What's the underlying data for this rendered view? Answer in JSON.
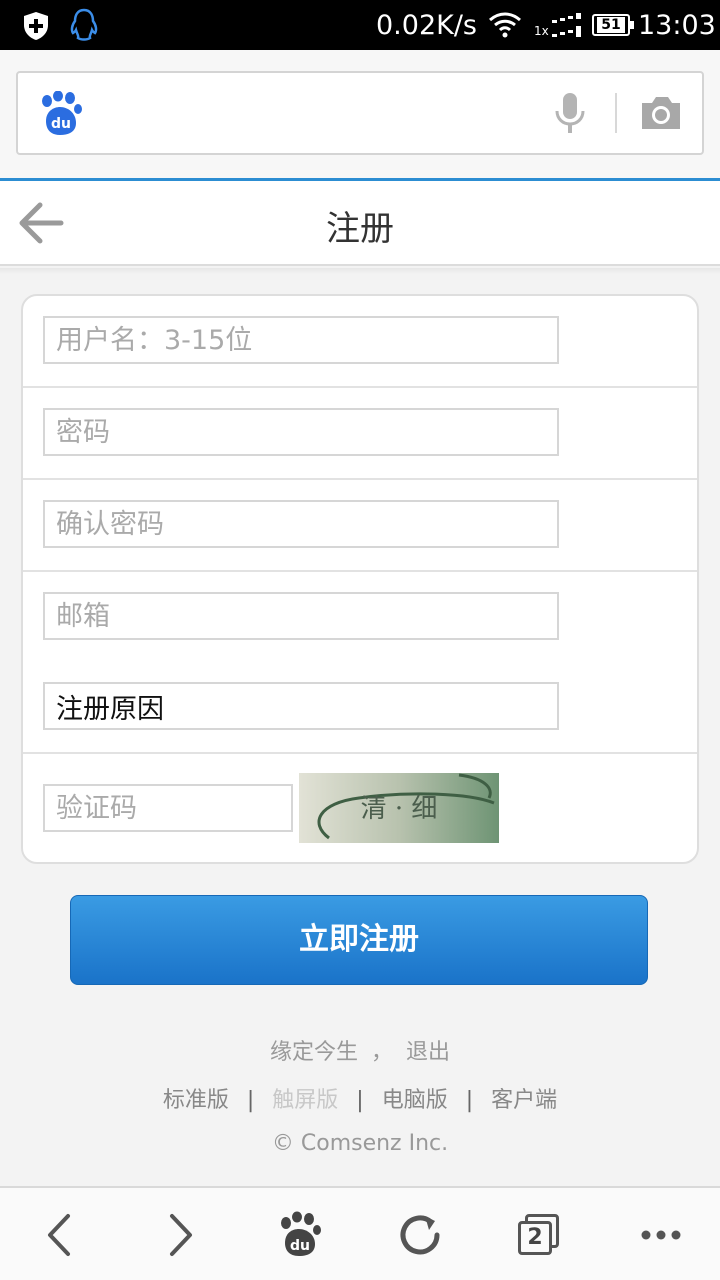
{
  "status_bar": {
    "net_speed": "0.02K/s",
    "signal_prefix": "1x",
    "battery": "51",
    "time": "13:03"
  },
  "browser": {
    "logo_text": "du"
  },
  "header": {
    "title": "注册"
  },
  "form": {
    "username_placeholder": "用户名：3-15位",
    "password_placeholder": "密码",
    "confirm_placeholder": "确认密码",
    "email_placeholder": "邮箱",
    "reason_value": "注册原因",
    "captcha_placeholder": "验证码",
    "captcha_text": "清 · 细"
  },
  "submit_label": "立即注册",
  "footer": {
    "username": "缘定今生",
    "comma": "，",
    "logout": "退出",
    "links": [
      "标准版",
      "触屏版",
      "电脑版",
      "客户端"
    ],
    "separator": "|",
    "copyright": "© Comsenz Inc."
  },
  "bottom_nav": {
    "tabs_count": "2"
  },
  "colors": {
    "accent": "#2c8dd2",
    "button_top": "#3a9be3",
    "button_bottom": "#1a73c9"
  }
}
